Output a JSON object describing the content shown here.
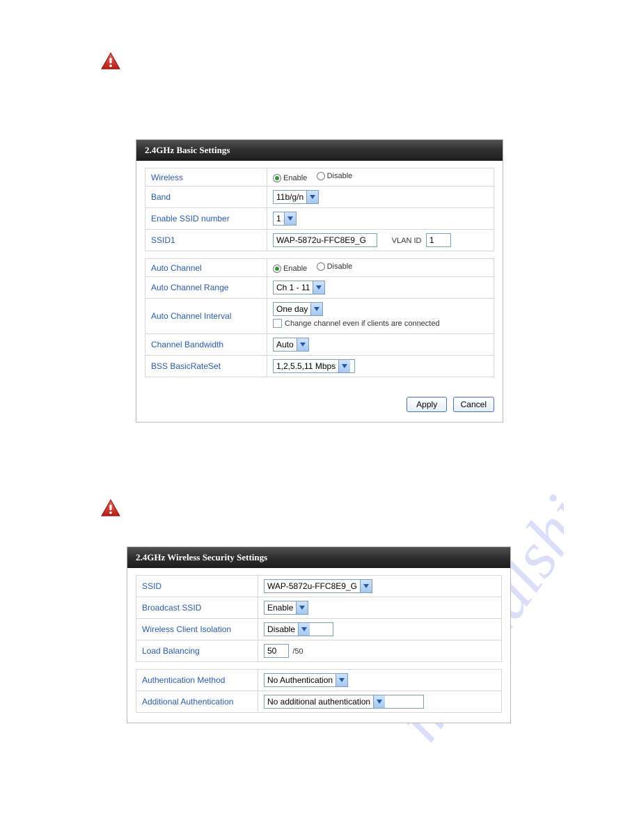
{
  "icons": {
    "warning": "warning"
  },
  "panel1": {
    "title": "2.4GHz Basic Settings",
    "rows": {
      "wireless": {
        "label": "Wireless",
        "enable": "Enable",
        "disable": "Disable"
      },
      "band": {
        "label": "Band",
        "value": "11b/g/n"
      },
      "enable_ssid_number": {
        "label": "Enable SSID number",
        "value": "1"
      },
      "ssid1": {
        "label": "SSID1",
        "value": "WAP-5872u-FFC8E9_G",
        "vlan_label": "VLAN ID",
        "vlan_value": "1"
      },
      "auto_channel": {
        "label": "Auto Channel",
        "enable": "Enable",
        "disable": "Disable"
      },
      "auto_channel_range": {
        "label": "Auto Channel Range",
        "value": "Ch 1 - 11"
      },
      "auto_channel_interval": {
        "label": "Auto Channel Interval",
        "value": "One day",
        "checkbox_label": "Change channel even if clients are connected"
      },
      "channel_bandwidth": {
        "label": "Channel Bandwidth",
        "value": "Auto"
      },
      "bss_basic_rate_set": {
        "label": "BSS BasicRateSet",
        "value": "1,2,5.5,11 Mbps"
      }
    },
    "buttons": {
      "apply": "Apply",
      "cancel": "Cancel"
    }
  },
  "panel2": {
    "title": "2.4GHz Wireless Security Settings",
    "rows": {
      "ssid": {
        "label": "SSID",
        "value": "WAP-5872u-FFC8E9_G"
      },
      "broadcast_ssid": {
        "label": "Broadcast SSID",
        "value": "Enable"
      },
      "wireless_client_isolation": {
        "label": "Wireless Client Isolation",
        "value": "Disable"
      },
      "load_balancing": {
        "label": "Load Balancing",
        "value": "50",
        "suffix": "/50"
      },
      "authentication_method": {
        "label": "Authentication Method",
        "value": "No Authentication"
      },
      "additional_authentication": {
        "label": "Additional Authentication",
        "value": "No additional authentication"
      }
    }
  },
  "watermark": "manualshive.com"
}
